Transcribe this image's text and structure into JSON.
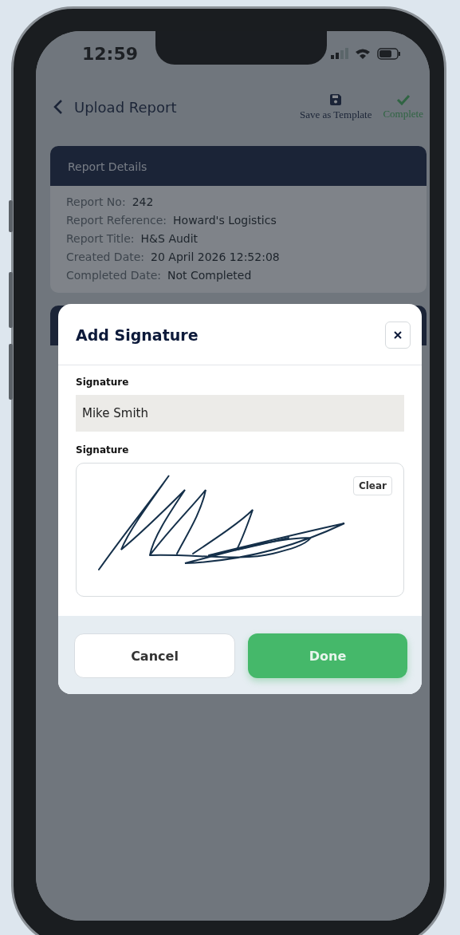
{
  "status_bar": {
    "time": "12:59"
  },
  "header": {
    "title": "Upload Report",
    "actions": [
      {
        "kind": "save",
        "label": "Save as Template"
      },
      {
        "kind": "complete",
        "label": "Complete"
      }
    ]
  },
  "report_details": {
    "title": "Report Details",
    "rows": [
      {
        "label": "Report No:",
        "value": "242"
      },
      {
        "label": "Report Reference:",
        "value": "Howard's Logistics"
      },
      {
        "label": "Report Title:",
        "value": "H&S Audit"
      },
      {
        "label": "Created Date:",
        "value": "20 April 2026 12:52:08"
      },
      {
        "label": "Completed Date:",
        "value": "Not Completed"
      }
    ]
  },
  "modal": {
    "title": "Add Signature",
    "fields": [
      {
        "kind": "text",
        "label": "Signature",
        "value": "Mike Smith"
      },
      {
        "kind": "signature",
        "label": "Signature",
        "clear_label": "Clear"
      }
    ],
    "buttons": [
      {
        "kind": "secondary",
        "label": "Cancel"
      },
      {
        "kind": "primary",
        "label": "Done"
      }
    ]
  }
}
